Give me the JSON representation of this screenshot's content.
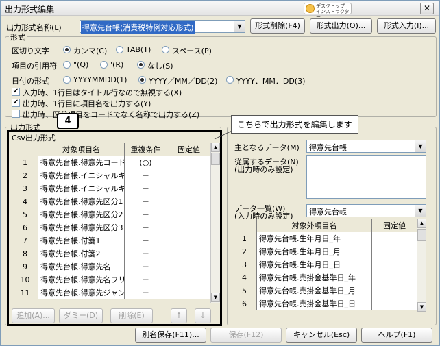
{
  "window": {
    "title": "出力形式編集",
    "badge_line1": "デスクトップ",
    "badge_line2": "インストラクター",
    "close_glyph": "✕"
  },
  "top": {
    "format_name_label": "出力形式名称(L)",
    "format_name_value": "得意先台帳(消費税特例対応形式)",
    "delete_button": "形式削除(F4)",
    "output_button": "形式出力(O)...",
    "input_button": "形式入力(I)..."
  },
  "format_group": {
    "title": "形式",
    "delimiter_label": "区切り文字",
    "delimiter_options": [
      "カンマ(C)",
      "TAB(T)",
      "スペース(P)"
    ],
    "delimiter_selected": 0,
    "quote_label": "項目の引用符",
    "quote_options": [
      "\"(Q)",
      "'(R)",
      "なし(S)"
    ],
    "quote_selected": 2,
    "date_label": "日付の形式",
    "date_options": [
      "YYYYMMDD(1)",
      "YYYY／MM／DD(2)",
      "YYYY．MM．DD(3)"
    ],
    "date_selected": 1,
    "checks": [
      {
        "label": "入力時、1行目はタイトル行なので無視する(X)",
        "checked": true
      },
      {
        "label": "出力時、1行目に項目名を出力する(Y)",
        "checked": true
      },
      {
        "label": "出力時、区分項目をコードでなく名称で出力する(Z)",
        "checked": false
      }
    ]
  },
  "output_group": {
    "title": "出力形式",
    "subtitle": "Csv出力形式",
    "headers": [
      "対象項目名",
      "重複条件",
      "固定値"
    ],
    "rows": [
      {
        "no": "1",
        "name": "得意先台帳.得意先コード",
        "dup": "(○)",
        "fixed": ""
      },
      {
        "no": "2",
        "name": "得意先台帳.イニシャルキ",
        "dup": "－",
        "fixed": ""
      },
      {
        "no": "3",
        "name": "得意先台帳.イニシャルキ",
        "dup": "－",
        "fixed": ""
      },
      {
        "no": "4",
        "name": "得意先台帳.得意先区分1",
        "dup": "－",
        "fixed": ""
      },
      {
        "no": "5",
        "name": "得意先台帳.得意先区分2",
        "dup": "－",
        "fixed": ""
      },
      {
        "no": "6",
        "name": "得意先台帳.得意先区分3",
        "dup": "－",
        "fixed": ""
      },
      {
        "no": "7",
        "name": "得意先台帳.付箋1",
        "dup": "－",
        "fixed": ""
      },
      {
        "no": "8",
        "name": "得意先台帳.付箋2",
        "dup": "－",
        "fixed": ""
      },
      {
        "no": "9",
        "name": "得意先台帳.得意先名",
        "dup": "－",
        "fixed": ""
      },
      {
        "no": "10",
        "name": "得意先台帳.得意先名フリ",
        "dup": "－",
        "fixed": ""
      },
      {
        "no": "11",
        "name": "得意先台帳.得意先ジャン",
        "dup": "－",
        "fixed": ""
      }
    ],
    "buttons": [
      "追加(A)...",
      "ダミー(D)",
      "削除(E)",
      "↑",
      "↓"
    ]
  },
  "right_panel": {
    "main_data_label": "主となるデータ(M)",
    "main_data_value": "得意先台帳",
    "sub_data_label_1": "従属するデータ(N)",
    "sub_data_label_2": "(出力時のみ設定)",
    "data_list_label_1": "データ一覧(W)",
    "data_list_label_2": "(入力時のみ設定)",
    "data_list_value": "得意先台帳",
    "headers": [
      "対象外項目名",
      "固定値"
    ],
    "rows": [
      {
        "no": "1",
        "name": "得意先台帳.生年月日_年",
        "fixed": ""
      },
      {
        "no": "2",
        "name": "得意先台帳.生年月日_月",
        "fixed": ""
      },
      {
        "no": "3",
        "name": "得意先台帳.生年月日_日",
        "fixed": ""
      },
      {
        "no": "4",
        "name": "得意先台帳.売掛金基準日_年",
        "fixed": ""
      },
      {
        "no": "5",
        "name": "得意先台帳.売掛金基準日_月",
        "fixed": ""
      },
      {
        "no": "6",
        "name": "得意先台帳.売掛金基準日_日",
        "fixed": ""
      }
    ]
  },
  "footer": {
    "save_as": "別名保存(F11)...",
    "save": "保存(F12)",
    "cancel": "キャンセル(Esc)",
    "help": "ヘルプ(F1)"
  },
  "annotation": {
    "step_number": "4",
    "callout_text": "こちらで出力形式を編集します"
  }
}
